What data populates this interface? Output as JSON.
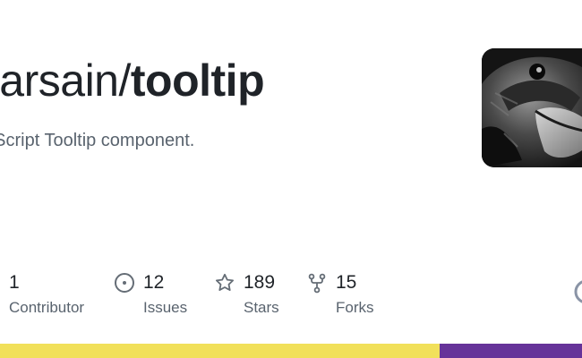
{
  "repo": {
    "owner": "darsain",
    "separator": "/",
    "name": "tooltip",
    "description": "vaScript Tooltip component."
  },
  "stats": [
    {
      "icon": "contributors-icon",
      "value": "1",
      "label": "Contributor"
    },
    {
      "icon": "issues-icon",
      "value": "12",
      "label": "Issues"
    },
    {
      "icon": "star-icon",
      "value": "189",
      "label": "Stars"
    },
    {
      "icon": "fork-icon",
      "value": "15",
      "label": "Forks"
    }
  ],
  "languages": [
    {
      "color": "#f1e05a",
      "share": 0.755
    },
    {
      "color": "#663399",
      "share": 0.245
    }
  ],
  "colors": {
    "text": "#1f2328",
    "muted": "#59636e",
    "icon": "#656d76"
  }
}
